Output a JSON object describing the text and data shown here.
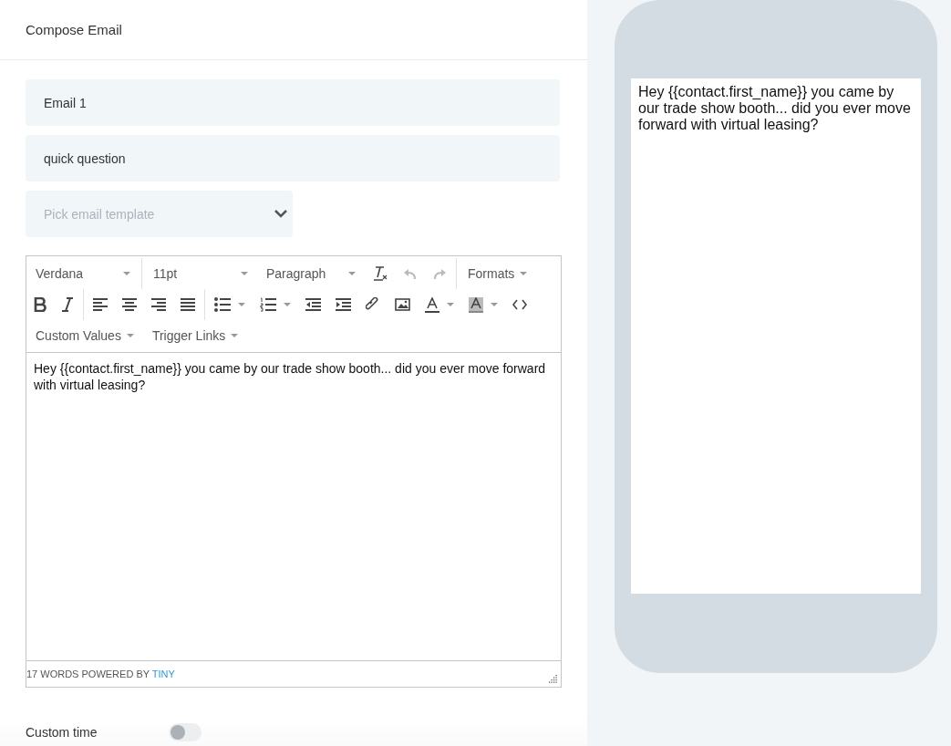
{
  "header": {
    "title": "Compose Email"
  },
  "fields": {
    "name": "Email 1",
    "subject": "quick question",
    "template_placeholder": "Pick email template"
  },
  "toolbar": {
    "font": "Verdana",
    "size": "11pt",
    "block": "Paragraph",
    "formats": "Formats",
    "undo": {
      "disabled": true
    },
    "redo": {
      "disabled": true
    },
    "menus": [
      "Custom Values",
      "Trigger Links"
    ]
  },
  "editor": {
    "body": "Hey {{contact.first_name}} you came by our trade show booth... did you ever move forward with virtual leasing?",
    "status": "17 WORDS POWERED BY",
    "status_link": "TINY"
  },
  "custom_time": {
    "label": "Custom time",
    "on": false
  },
  "preview": {
    "text": "Hey {{contact.first_name}} you came by our trade show booth... did you ever move forward with virtual leasing?"
  }
}
